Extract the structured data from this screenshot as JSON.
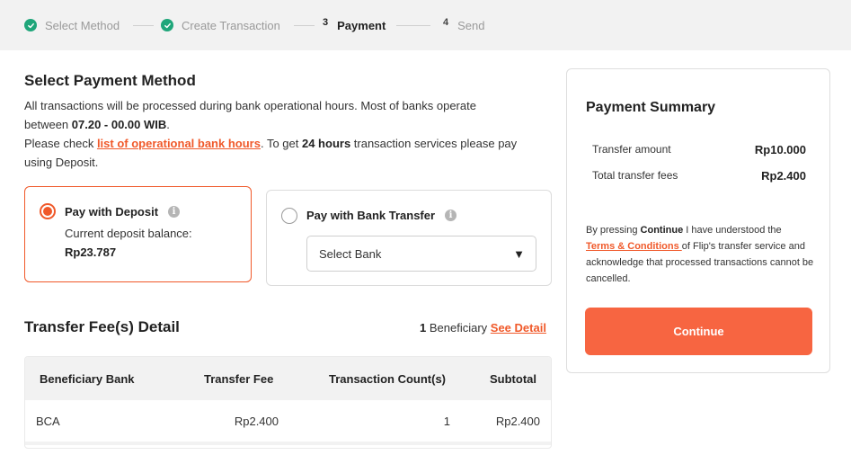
{
  "stepper": {
    "steps": [
      {
        "label": "Select Method",
        "state": "done"
      },
      {
        "label": "Create Transaction",
        "state": "done"
      },
      {
        "number": "3",
        "label": "Payment",
        "state": "active"
      },
      {
        "number": "4",
        "label": "Send",
        "state": "pending"
      }
    ]
  },
  "payment_method": {
    "title": "Select Payment Method",
    "info_line1_a": "All transactions will be processed during bank operational hours. Most of banks operate",
    "info_line2_a": "between ",
    "info_line2_b": "07.20 - 00.00 WIB",
    "info_line2_c": ".",
    "info_line3_a": "Please check ",
    "info_line3_link": "list of operational bank hours",
    "info_line3_b": ". To get ",
    "info_line3_c": "24 hours",
    "info_line3_d": " transaction services please pay",
    "info_line4": "using Deposit.",
    "deposit": {
      "title": "Pay with Deposit",
      "balance_label": "Current deposit balance:",
      "balance_value": "Rp23.787",
      "selected": true
    },
    "bank_transfer": {
      "title": "Pay with Bank Transfer",
      "select_placeholder": "Select Bank",
      "selected": false
    }
  },
  "fee_detail": {
    "title": "Transfer Fee(s) Detail",
    "beneficiary_count": "1",
    "beneficiary_label": " Beneficiary ",
    "see_detail": "See Detail",
    "columns": [
      "Beneficiary Bank",
      "Transfer Fee",
      "Transaction Count(s)",
      "Subtotal"
    ],
    "rows": [
      [
        "BCA",
        "Rp2.400",
        "1",
        "Rp2.400"
      ]
    ]
  },
  "summary": {
    "title": "Payment Summary",
    "transfer_amount_label": "Transfer amount",
    "transfer_amount_value": "Rp10.000",
    "total_fees_label": "Total transfer fees",
    "total_fees_value": "Rp2.400",
    "note_a": "By pressing ",
    "note_b": "Continue",
    "note_c": " I have understood the",
    "note_link": "Terms & Conditions ",
    "note_d": "of Flip's transfer service and acknowledge that processed transactions cannot be cancelled.",
    "continue_label": "Continue"
  },
  "colors": {
    "accent": "#f0592a",
    "button": "#f76541",
    "done": "#1fa67a"
  },
  "icons": {
    "info": "i"
  }
}
